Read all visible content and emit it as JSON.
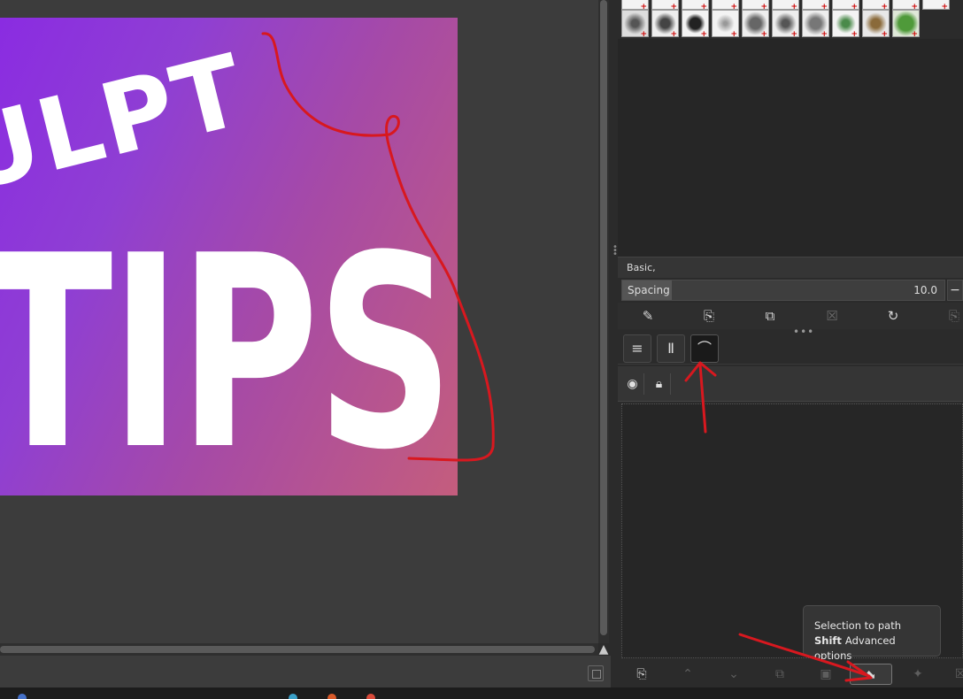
{
  "canvas": {
    "image_text_line1": "ULPT",
    "image_text_line2": "TIPS"
  },
  "brushes": {
    "preset_name": "Basic,",
    "spacing_label": "Spacing",
    "spacing_value": "10.0",
    "spacing_fraction": 0.1
  },
  "tooltip": {
    "title": "Selection to path",
    "modifier": "Shift",
    "modifier_action": "Advanced options"
  },
  "colors": {
    "annotation_red": "#d8181f",
    "gradient_start": "#8a2be2",
    "gradient_end": "#c45d7d"
  }
}
